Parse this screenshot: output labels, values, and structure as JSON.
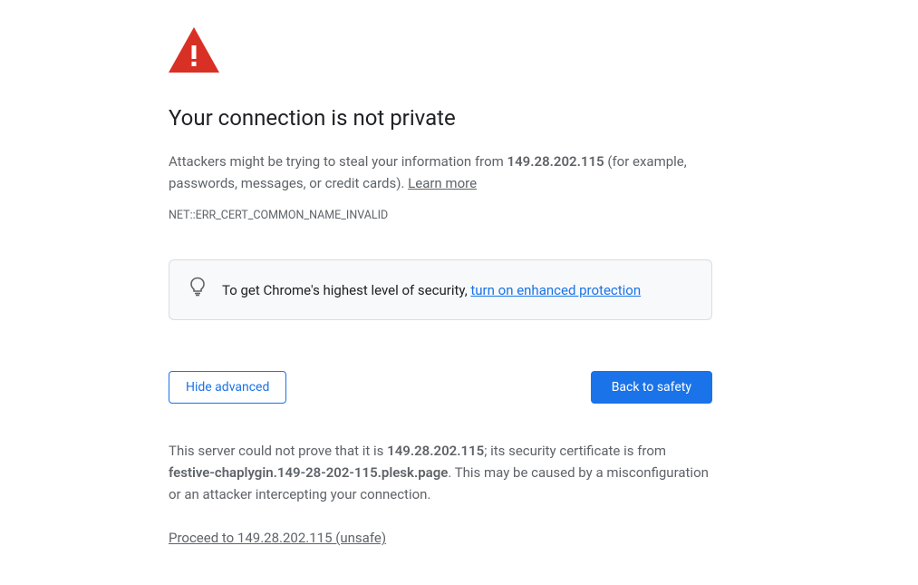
{
  "heading": "Your connection is not private",
  "description": {
    "prefix": "Attackers might be trying to steal your information from ",
    "host": "149.28.202.115",
    "suffix": " (for example, passwords, messages, or credit cards). ",
    "learn_more": "Learn more"
  },
  "error_code": "NET::ERR_CERT_COMMON_NAME_INVALID",
  "info_box": {
    "prefix": "To get Chrome's highest level of security, ",
    "link": "turn on enhanced protection"
  },
  "buttons": {
    "hide_advanced": "Hide advanced",
    "back_to_safety": "Back to safety"
  },
  "advanced": {
    "part1": "This server could not prove that it is ",
    "host": "149.28.202.115",
    "part2": "; its security certificate is from ",
    "cert_domain": "festive-chaplygin.149-28-202-115.plesk.page",
    "part3": ". This may be caused by a misconfiguration or an attacker intercepting your connection."
  },
  "proceed_link": "Proceed to 149.28.202.115 (unsafe)",
  "colors": {
    "danger": "#d93025",
    "link": "#1a73e8",
    "text_secondary": "#5f6368"
  }
}
